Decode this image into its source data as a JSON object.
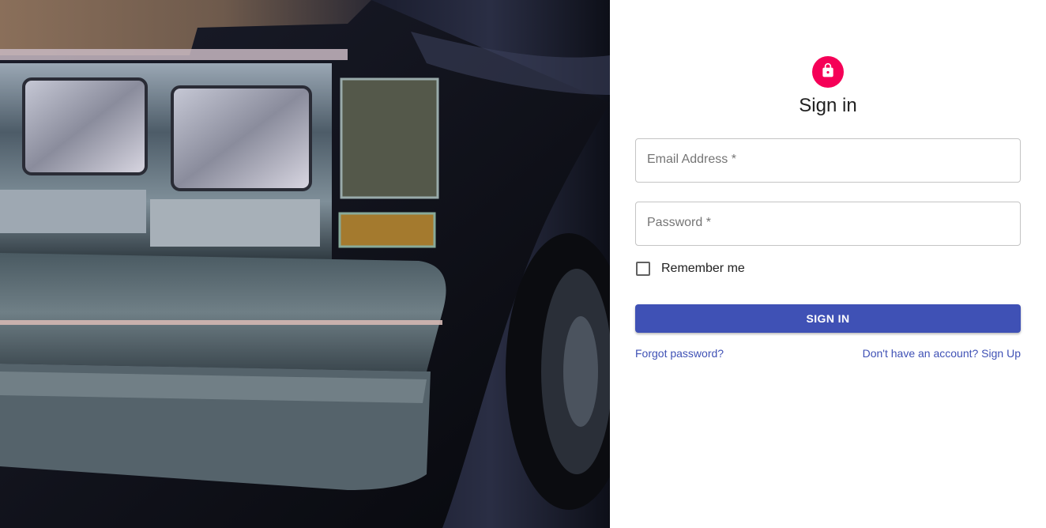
{
  "hero": {
    "image_description_icon": "car-photo"
  },
  "avatar": {
    "icon": "lock-icon",
    "color": "#f50057"
  },
  "form": {
    "title": "Sign in",
    "email": {
      "label": "Email Address *",
      "value": ""
    },
    "password": {
      "label": "Password *",
      "value": ""
    },
    "remember_label": "Remember me",
    "submit_label": "SIGN IN",
    "forgot_link": "Forgot password?",
    "signup_link": "Don't have an account? Sign Up"
  },
  "colors": {
    "primary": "#3f51b5",
    "secondary": "#f50057"
  }
}
